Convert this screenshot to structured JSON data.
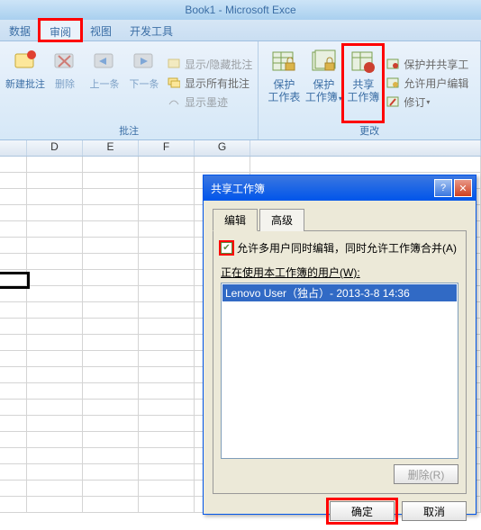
{
  "app": {
    "title": "Book1 - Microsoft Exce"
  },
  "tabs": {
    "data": "数据",
    "review": "审阅",
    "view": "视图",
    "dev": "开发工具"
  },
  "ribbon": {
    "group_comments_label": "批注",
    "group_changes_label": "更改",
    "new_comment": "新建批注",
    "delete": "删除",
    "prev": "上一条",
    "next": "下一条",
    "show_hide": "显示/隐藏批注",
    "show_all": "显示所有批注",
    "show_ink": "显示墨迹",
    "protect_sheet_l1": "保护",
    "protect_sheet_l2": "工作表",
    "protect_book_l1": "保护",
    "protect_book_l2": "工作簿",
    "share_book_l1": "共享",
    "share_book_l2": "工作簿",
    "protect_share": "保护并共享工",
    "allow_edit": "允许用户编辑",
    "track_changes": "修订"
  },
  "columns": {
    "c1": "D",
    "c2": "E",
    "c3": "F",
    "c4": "G"
  },
  "dialog": {
    "title": "共享工作簿",
    "tab_edit": "编辑",
    "tab_advanced": "高级",
    "checkbox_label": "允许多用户同时编辑，同时允许工作簿合并(A)",
    "users_label": "正在使用本工作簿的用户(W):",
    "user1": "Lenovo User（独占）- 2013-3-8 14:36",
    "remove_btn": "删除(R)",
    "ok": "确定",
    "cancel": "取消"
  }
}
